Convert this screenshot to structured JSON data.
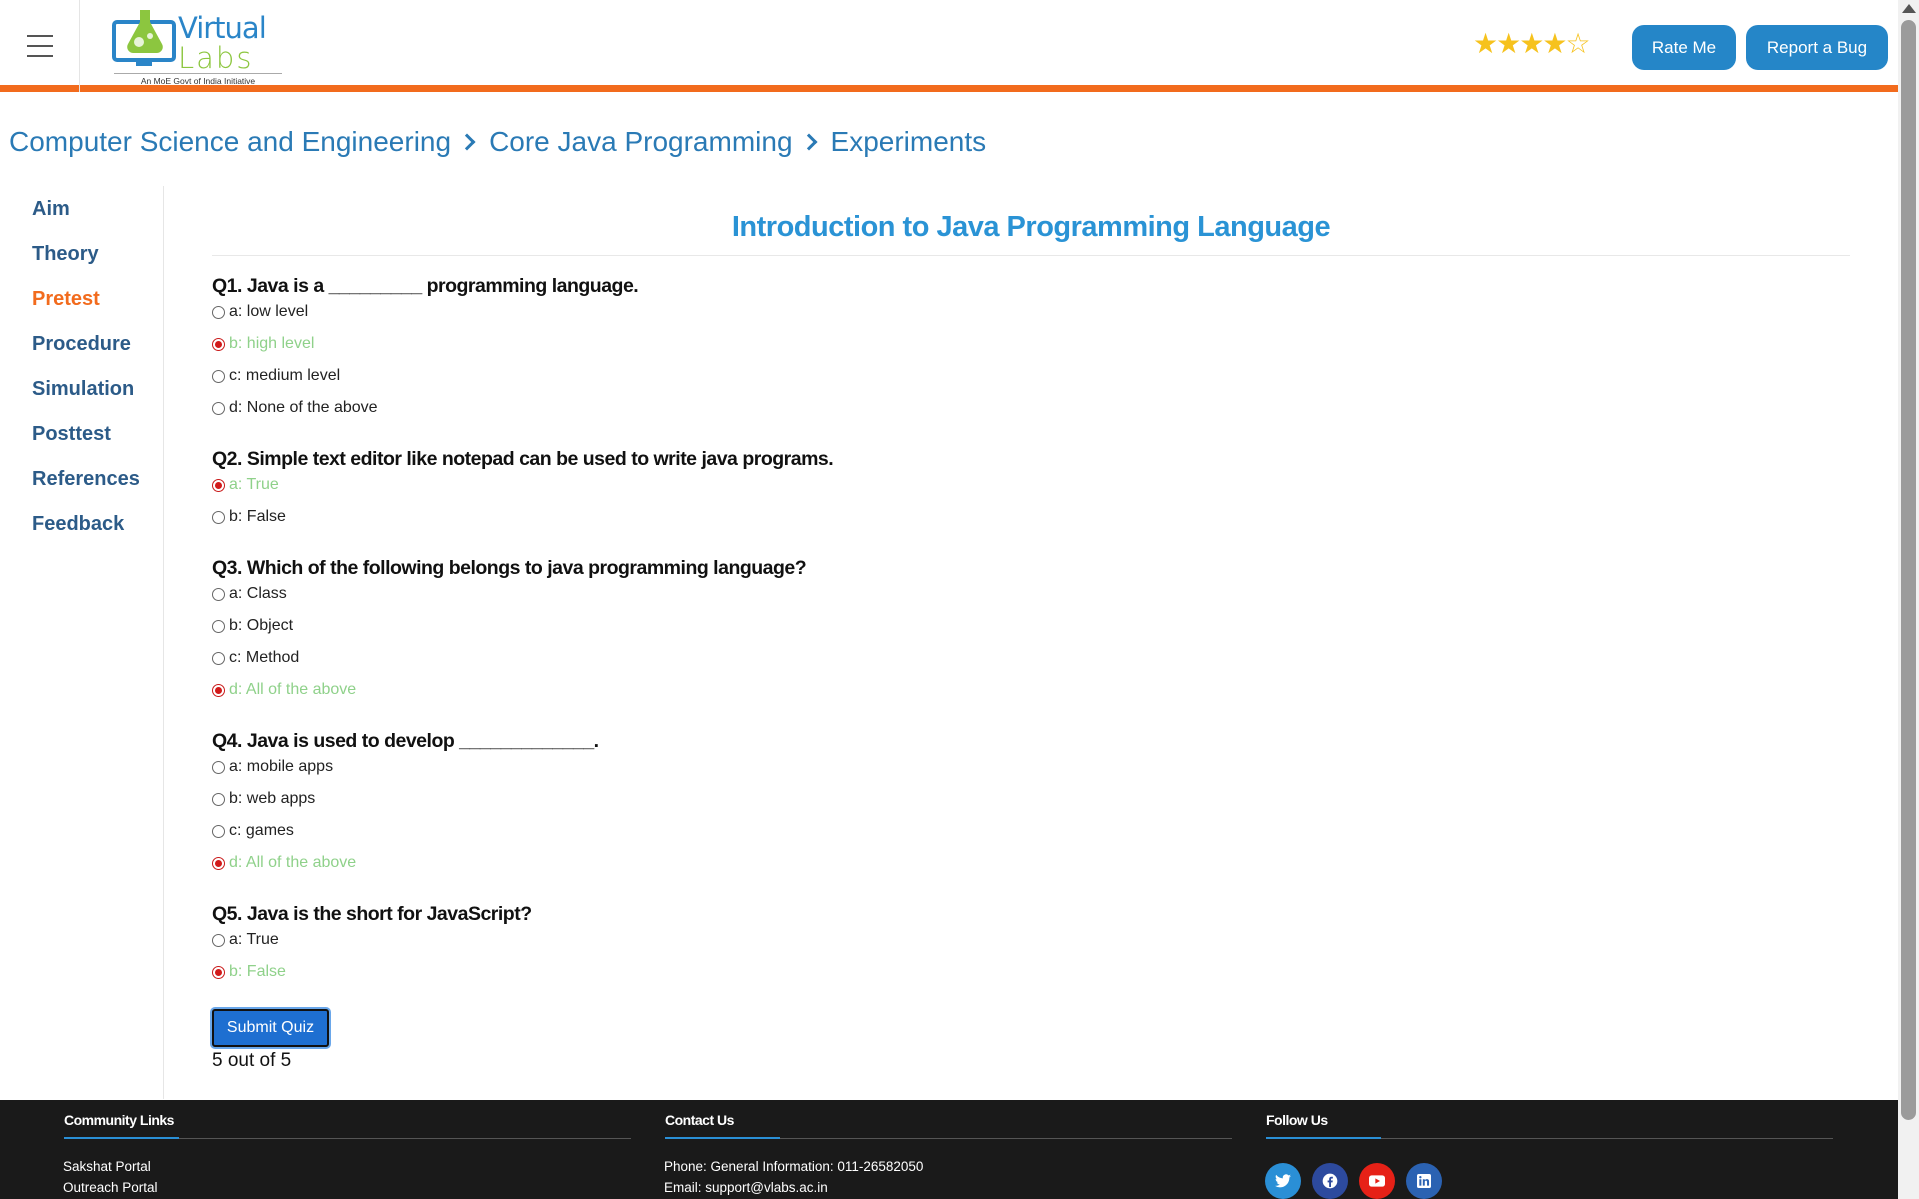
{
  "header": {
    "logo_title_1": "Virtual",
    "logo_title_2": "Labs",
    "logo_tagline": "An MoE Govt of India Initiative",
    "rating": 4,
    "rating_max": 5,
    "rate_button": "Rate Me",
    "bug_button": "Report a Bug"
  },
  "breadcrumb": [
    "Computer Science and Engineering",
    "Core Java Programming",
    "Experiments"
  ],
  "sidebar": {
    "items": [
      "Aim",
      "Theory",
      "Pretest",
      "Procedure",
      "Simulation",
      "Posttest",
      "References",
      "Feedback"
    ],
    "active": "Pretest"
  },
  "main": {
    "title": "Introduction to Java Programming Language",
    "questions": [
      {
        "text": "Q1. Java is a _________ programming language.",
        "options": [
          "a: low level",
          "b: high level",
          "c: medium level",
          "d: None of the above"
        ],
        "selected": 1
      },
      {
        "text": "Q2. Simple text editor like notepad can be used to write java programs.",
        "options": [
          "a: True",
          "b: False"
        ],
        "selected": 0
      },
      {
        "text": "Q3. Which of the following belongs to java programming language?",
        "options": [
          "a: Class",
          "b: Object",
          "c: Method",
          "d: All of the above"
        ],
        "selected": 3
      },
      {
        "text": "Q4. Java is used to develop _____________.",
        "options": [
          "a: mobile apps",
          "b: web apps",
          "c: games",
          "d: All of the above"
        ],
        "selected": 3
      },
      {
        "text": "Q5. Java is the short for JavaScript?",
        "options": [
          "a: True",
          "b: False"
        ],
        "selected": 1
      }
    ],
    "submit_label": "Submit Quiz",
    "score": "5 out of 5"
  },
  "footer": {
    "community_title": "Community Links",
    "community_links": [
      "Sakshat Portal",
      "Outreach Portal"
    ],
    "contact_title": "Contact Us",
    "contact_phone": "Phone: General Information: 011-26582050",
    "contact_email": "Email: support@vlabs.ac.in",
    "follow_title": "Follow Us",
    "social": [
      "twitter-icon",
      "facebook-icon",
      "youtube-icon",
      "linkedin-icon"
    ]
  },
  "colors": {
    "accent_orange": "#f26b1d",
    "brand_blue": "#2586c8",
    "selected_answer": "#8fd18a",
    "footer_bg": "#1a1a1a"
  }
}
